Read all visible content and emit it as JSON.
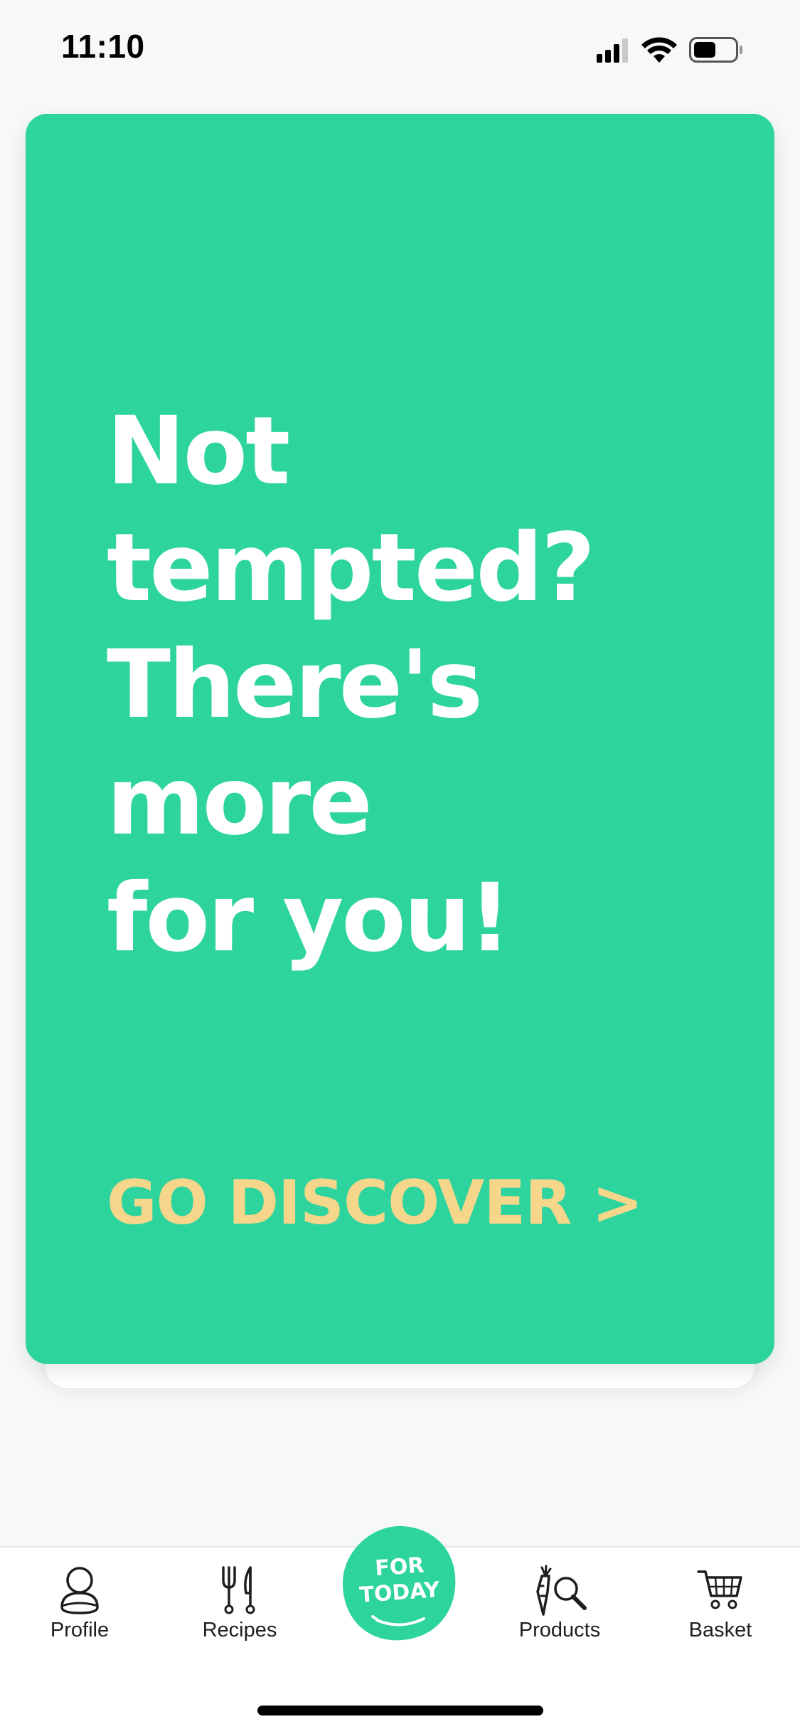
{
  "status_bar": {
    "time": "11:10",
    "icons": [
      "signal-icon",
      "wifi-icon",
      "battery-icon"
    ]
  },
  "card": {
    "headline": "Not tempted?\nThere's\nmore\nfor you!",
    "cta_label": "GO DISCOVER >",
    "colors": {
      "background": "#2dd49e",
      "headline": "#ffffff",
      "cta": "#f6d68a"
    }
  },
  "tab_bar": {
    "items": [
      {
        "label": "Profile",
        "icon": "profile-icon"
      },
      {
        "label": "Recipes",
        "icon": "fork-knife-icon"
      },
      {
        "label": "Products",
        "icon": "carrot-magnifier-icon"
      },
      {
        "label": "Basket",
        "icon": "cart-icon"
      }
    ],
    "center_button": {
      "line1": "FOR",
      "line2": "TODAY",
      "color": "#2dd49e"
    }
  }
}
